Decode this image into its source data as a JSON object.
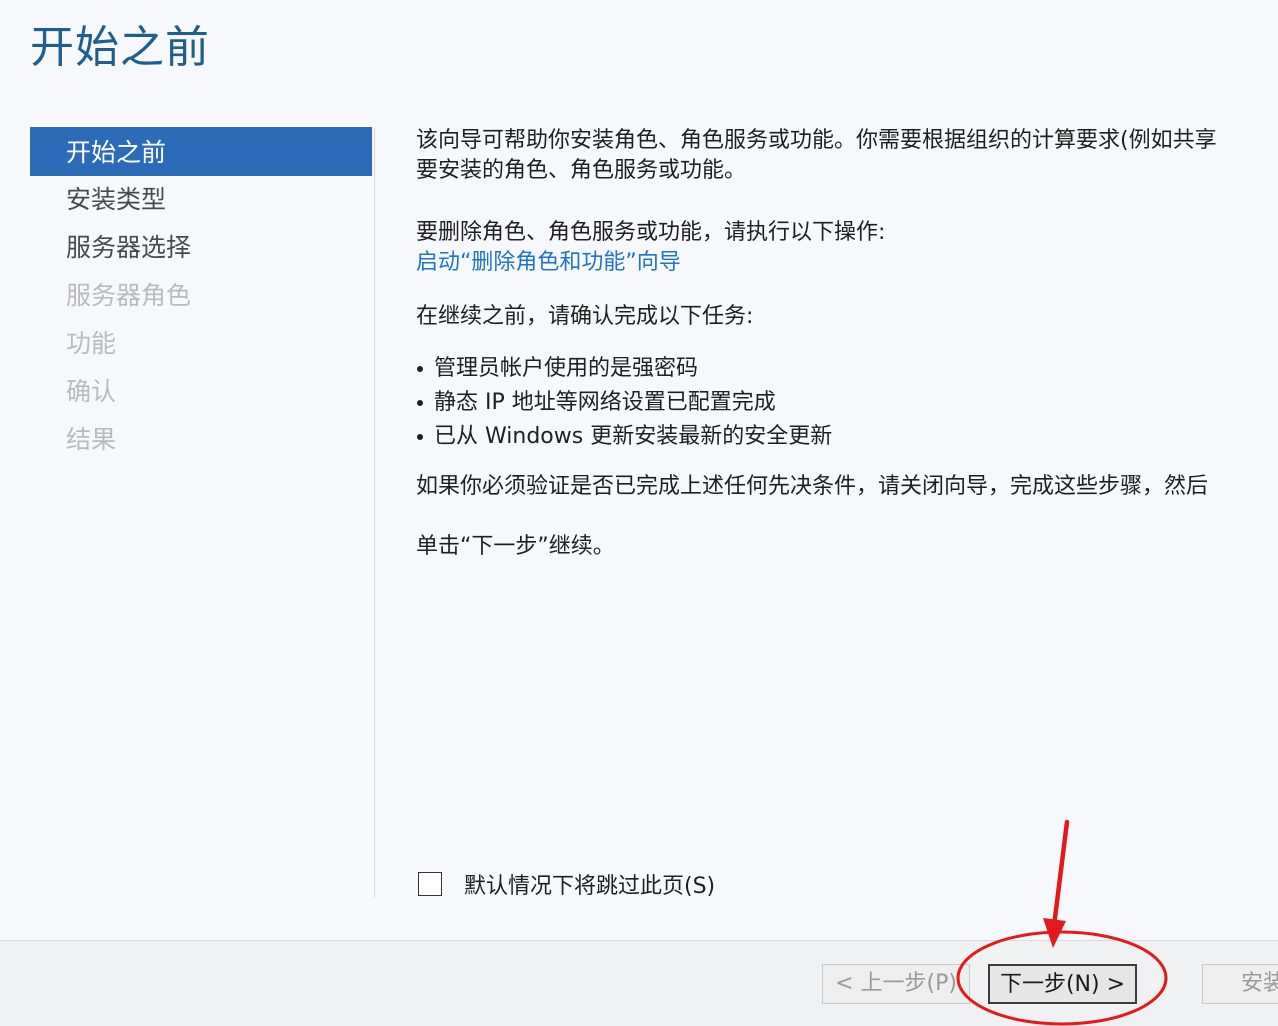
{
  "wizard": {
    "title": "开始之前"
  },
  "nav": {
    "items": [
      {
        "label": "开始之前",
        "state": "active"
      },
      {
        "label": "安装类型",
        "state": "enabled"
      },
      {
        "label": "服务器选择",
        "state": "enabled"
      },
      {
        "label": "服务器角色",
        "state": "disabled"
      },
      {
        "label": "功能",
        "state": "disabled"
      },
      {
        "label": "确认",
        "state": "disabled"
      },
      {
        "label": "结果",
        "state": "disabled"
      }
    ]
  },
  "content": {
    "intro_line1": "该向导可帮助你安装角色、角色服务或功能。你需要根据组织的计算要求(例如共享",
    "intro_line2": "要安装的角色、角色服务或功能。",
    "remove_text": "要删除角色、角色服务或功能，请执行以下操作:",
    "remove_link": "启动“删除角色和功能”向导",
    "confirm_text": "在继续之前，请确认完成以下任务:",
    "tasks": [
      "管理员帐户使用的是强密码",
      "静态 IP 地址等网络设置已配置完成",
      "已从 Windows 更新安装最新的安全更新"
    ],
    "prereq_text": "如果你必须验证是否已完成上述任何先决条件，请关闭向导，完成这些步骤，然后",
    "next_text": "单击“下一步”继续。"
  },
  "skip_checkbox": {
    "label": "默认情况下将跳过此页(S)",
    "checked": false
  },
  "footer": {
    "prev_label": "< 上一步(P)",
    "next_label": "下一步(N) >",
    "install_label": "安装"
  },
  "colors": {
    "title": "#1f5f8f",
    "nav_active_bg": "#2c6bb8",
    "link": "#1f73c8",
    "annotation": "#e3191c"
  }
}
